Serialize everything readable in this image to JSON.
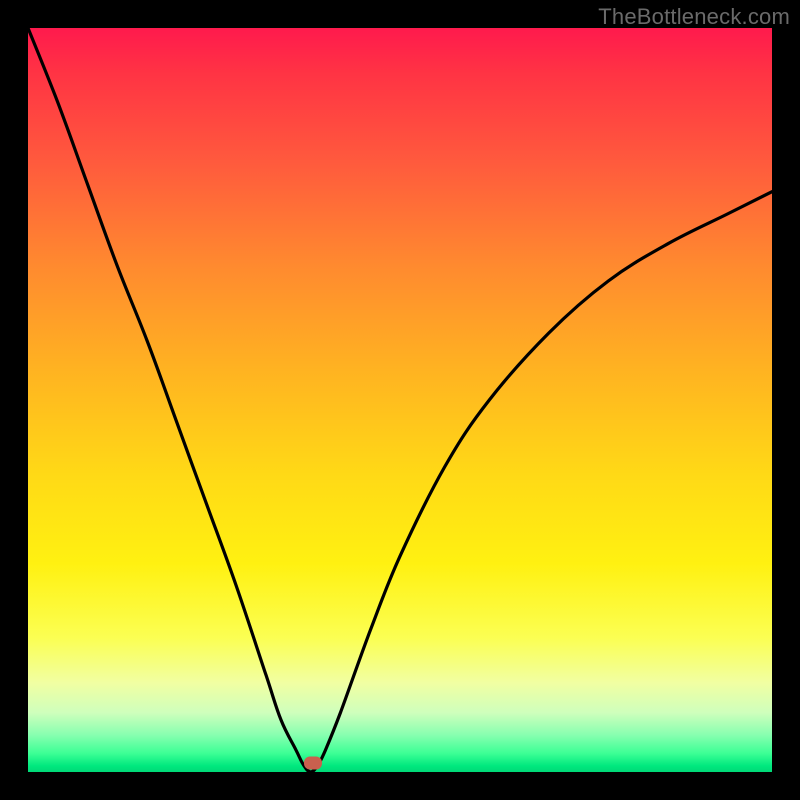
{
  "watermark": "TheBottleneck.com",
  "colors": {
    "frame": "#000000",
    "curve": "#000000",
    "marker": "#c9604e"
  },
  "chart_data": {
    "type": "line",
    "title": "",
    "xlabel": "",
    "ylabel": "",
    "xlim": [
      0,
      100
    ],
    "ylim": [
      0,
      100
    ],
    "grid": false,
    "note": "V-shaped bottleneck curve on red→green vertical gradient. y represents bottleneck % (0 at bottom/green, 100 at top/red). Curve dips to 0 near x≈38.",
    "x": [
      0,
      4,
      8,
      12,
      16,
      20,
      24,
      28,
      32,
      34,
      36,
      37,
      38,
      39,
      40,
      42,
      46,
      50,
      56,
      62,
      70,
      78,
      86,
      94,
      100
    ],
    "y": [
      100,
      90,
      79,
      68,
      58,
      47,
      36,
      25,
      13,
      7,
      3,
      1,
      0,
      1,
      3,
      8,
      19,
      29,
      41,
      50,
      59,
      66,
      71,
      75,
      78
    ],
    "marker": {
      "x": 38.3,
      "y": 1.2
    },
    "gradient_stops": [
      {
        "pos": 0,
        "color": "#ff1a4d"
      },
      {
        "pos": 50,
        "color": "#ffd916"
      },
      {
        "pos": 88,
        "color": "#f1ffa2"
      },
      {
        "pos": 100,
        "color": "#00d877"
      }
    ]
  }
}
